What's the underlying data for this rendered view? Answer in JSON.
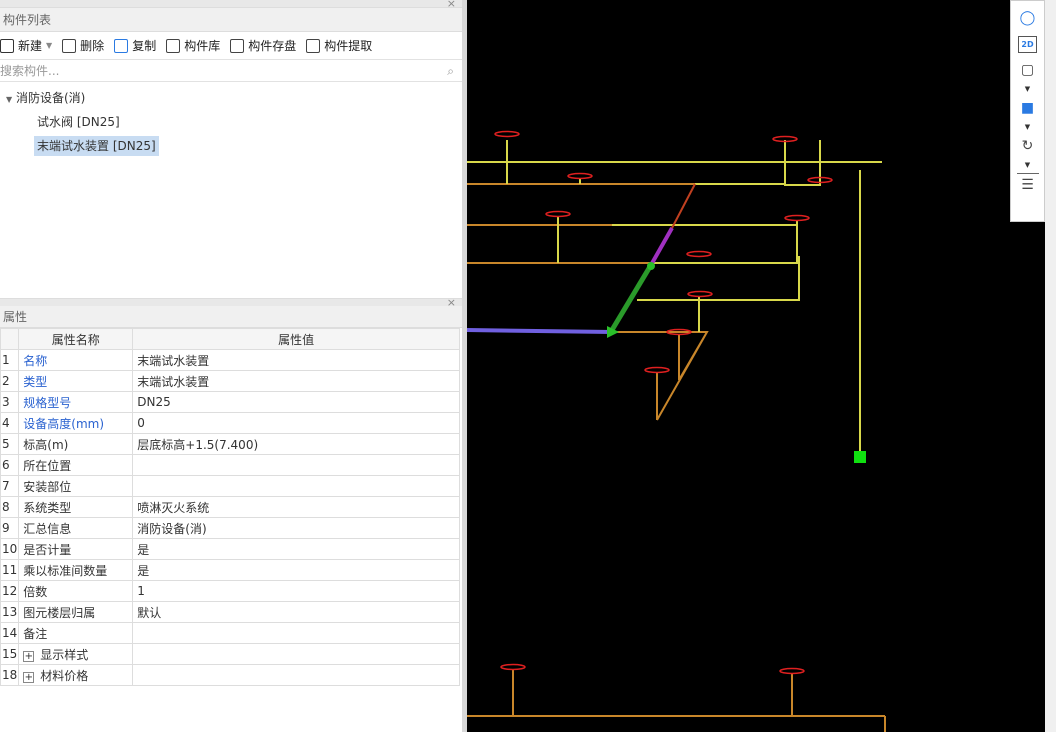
{
  "component_list": {
    "title": "构件列表",
    "toolbar": {
      "new": "新建",
      "delete": "删除",
      "copy": "复制",
      "library": "构件库",
      "save": "构件存盘",
      "extract": "构件提取"
    },
    "search_placeholder": "搜索构件...",
    "tree": {
      "group": "消防设备(消)",
      "items": [
        "试水阀 [DN25]",
        "末端试水装置 [DN25]"
      ],
      "selected": 1
    }
  },
  "properties": {
    "title": "属性",
    "headers": [
      "属性名称",
      "属性值"
    ],
    "rows": [
      {
        "n": "1",
        "k": "名称",
        "v": "末端试水装置",
        "blue": true
      },
      {
        "n": "2",
        "k": "类型",
        "v": "末端试水装置",
        "blue": true
      },
      {
        "n": "3",
        "k": "规格型号",
        "v": "DN25",
        "blue": true
      },
      {
        "n": "4",
        "k": "设备高度(mm)",
        "v": "0",
        "blue": true
      },
      {
        "n": "5",
        "k": "标高(m)",
        "v": "层底标高+1.5(7.400)"
      },
      {
        "n": "6",
        "k": "所在位置",
        "v": ""
      },
      {
        "n": "7",
        "k": "安装部位",
        "v": ""
      },
      {
        "n": "8",
        "k": "系统类型",
        "v": "喷淋灭火系统"
      },
      {
        "n": "9",
        "k": "汇总信息",
        "v": "消防设备(消)"
      },
      {
        "n": "10",
        "k": "是否计量",
        "v": "是"
      },
      {
        "n": "11",
        "k": "乘以标准间数量",
        "v": "是"
      },
      {
        "n": "12",
        "k": "倍数",
        "v": "1"
      },
      {
        "n": "13",
        "k": "图元楼层归属",
        "v": "默认"
      },
      {
        "n": "14",
        "k": "备注",
        "v": ""
      },
      {
        "n": "15",
        "k": "显示样式",
        "v": "",
        "expand": true
      },
      {
        "n": "18",
        "k": "材料价格",
        "v": "",
        "expand": true
      }
    ]
  },
  "view_toolbar": {
    "mode_2d": "2D"
  }
}
